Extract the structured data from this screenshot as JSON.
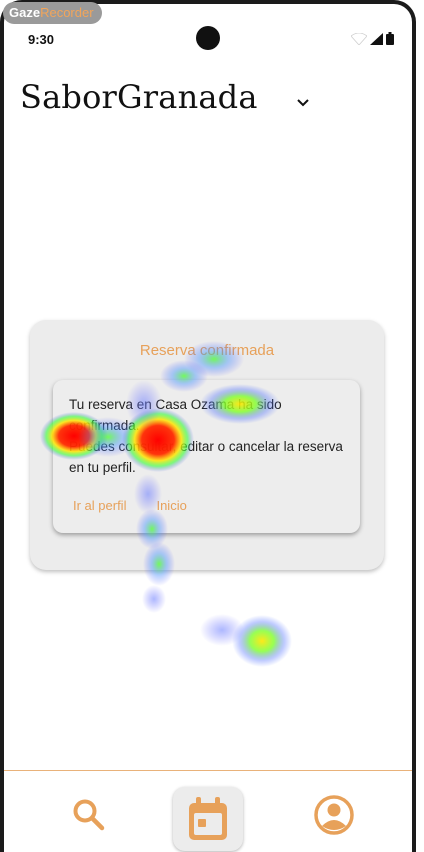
{
  "recorder": {
    "brand": "Gaze",
    "label": "Recorder"
  },
  "status": {
    "time": "9:30"
  },
  "app": {
    "title": "SaborGranada"
  },
  "dialog": {
    "title": "Reserva confirmada",
    "message_1": "Tu reserva en Casa Ozama ha sido confirmada.",
    "message_2": "Puedes consultar, editar o cancelar la reserva en tu perfil.",
    "action_profile": "Ir al perfil",
    "action_home": "Inicio"
  },
  "nav": {
    "items": [
      {
        "icon": "search-icon",
        "active": false
      },
      {
        "icon": "calendar-icon",
        "active": true
      },
      {
        "icon": "profile-icon",
        "active": false
      }
    ]
  },
  "colors": {
    "accent": "#e7a15a",
    "card": "#ececec",
    "divider": "#e9b27a"
  }
}
